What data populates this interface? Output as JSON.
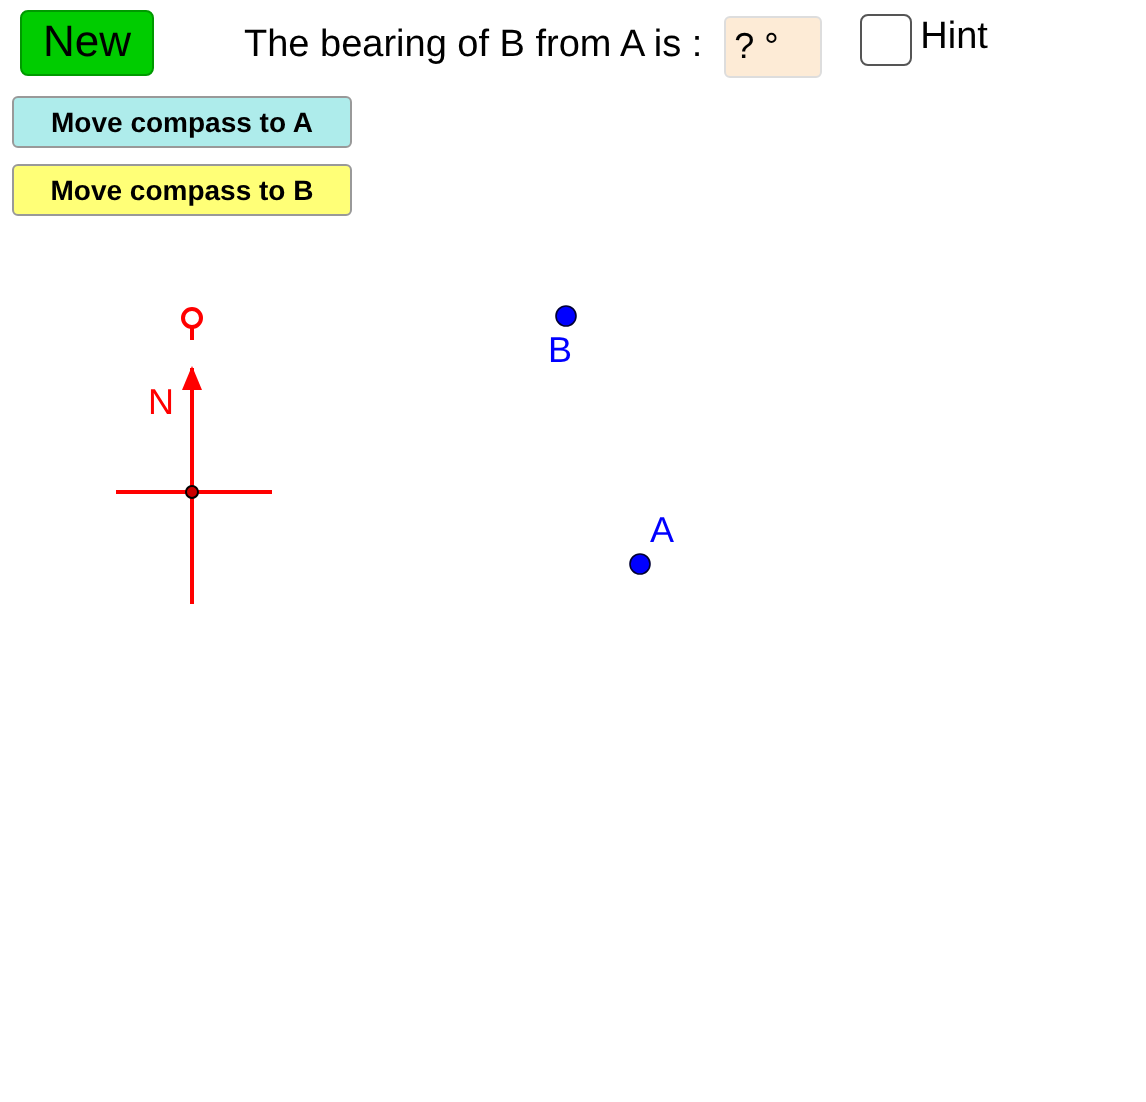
{
  "new_button": {
    "label": "New"
  },
  "question": {
    "text": "The bearing of B from A is :",
    "answer": "? °"
  },
  "hint": {
    "label": "Hint",
    "checked": false
  },
  "buttons": [
    {
      "label": "Move compass to A",
      "color": "#aeeceb"
    },
    {
      "label": "Move compass to B",
      "color": "#ffff77"
    }
  ],
  "compass": {
    "north_label": "N"
  },
  "points": [
    {
      "label": "B"
    },
    {
      "label": "A"
    }
  ]
}
